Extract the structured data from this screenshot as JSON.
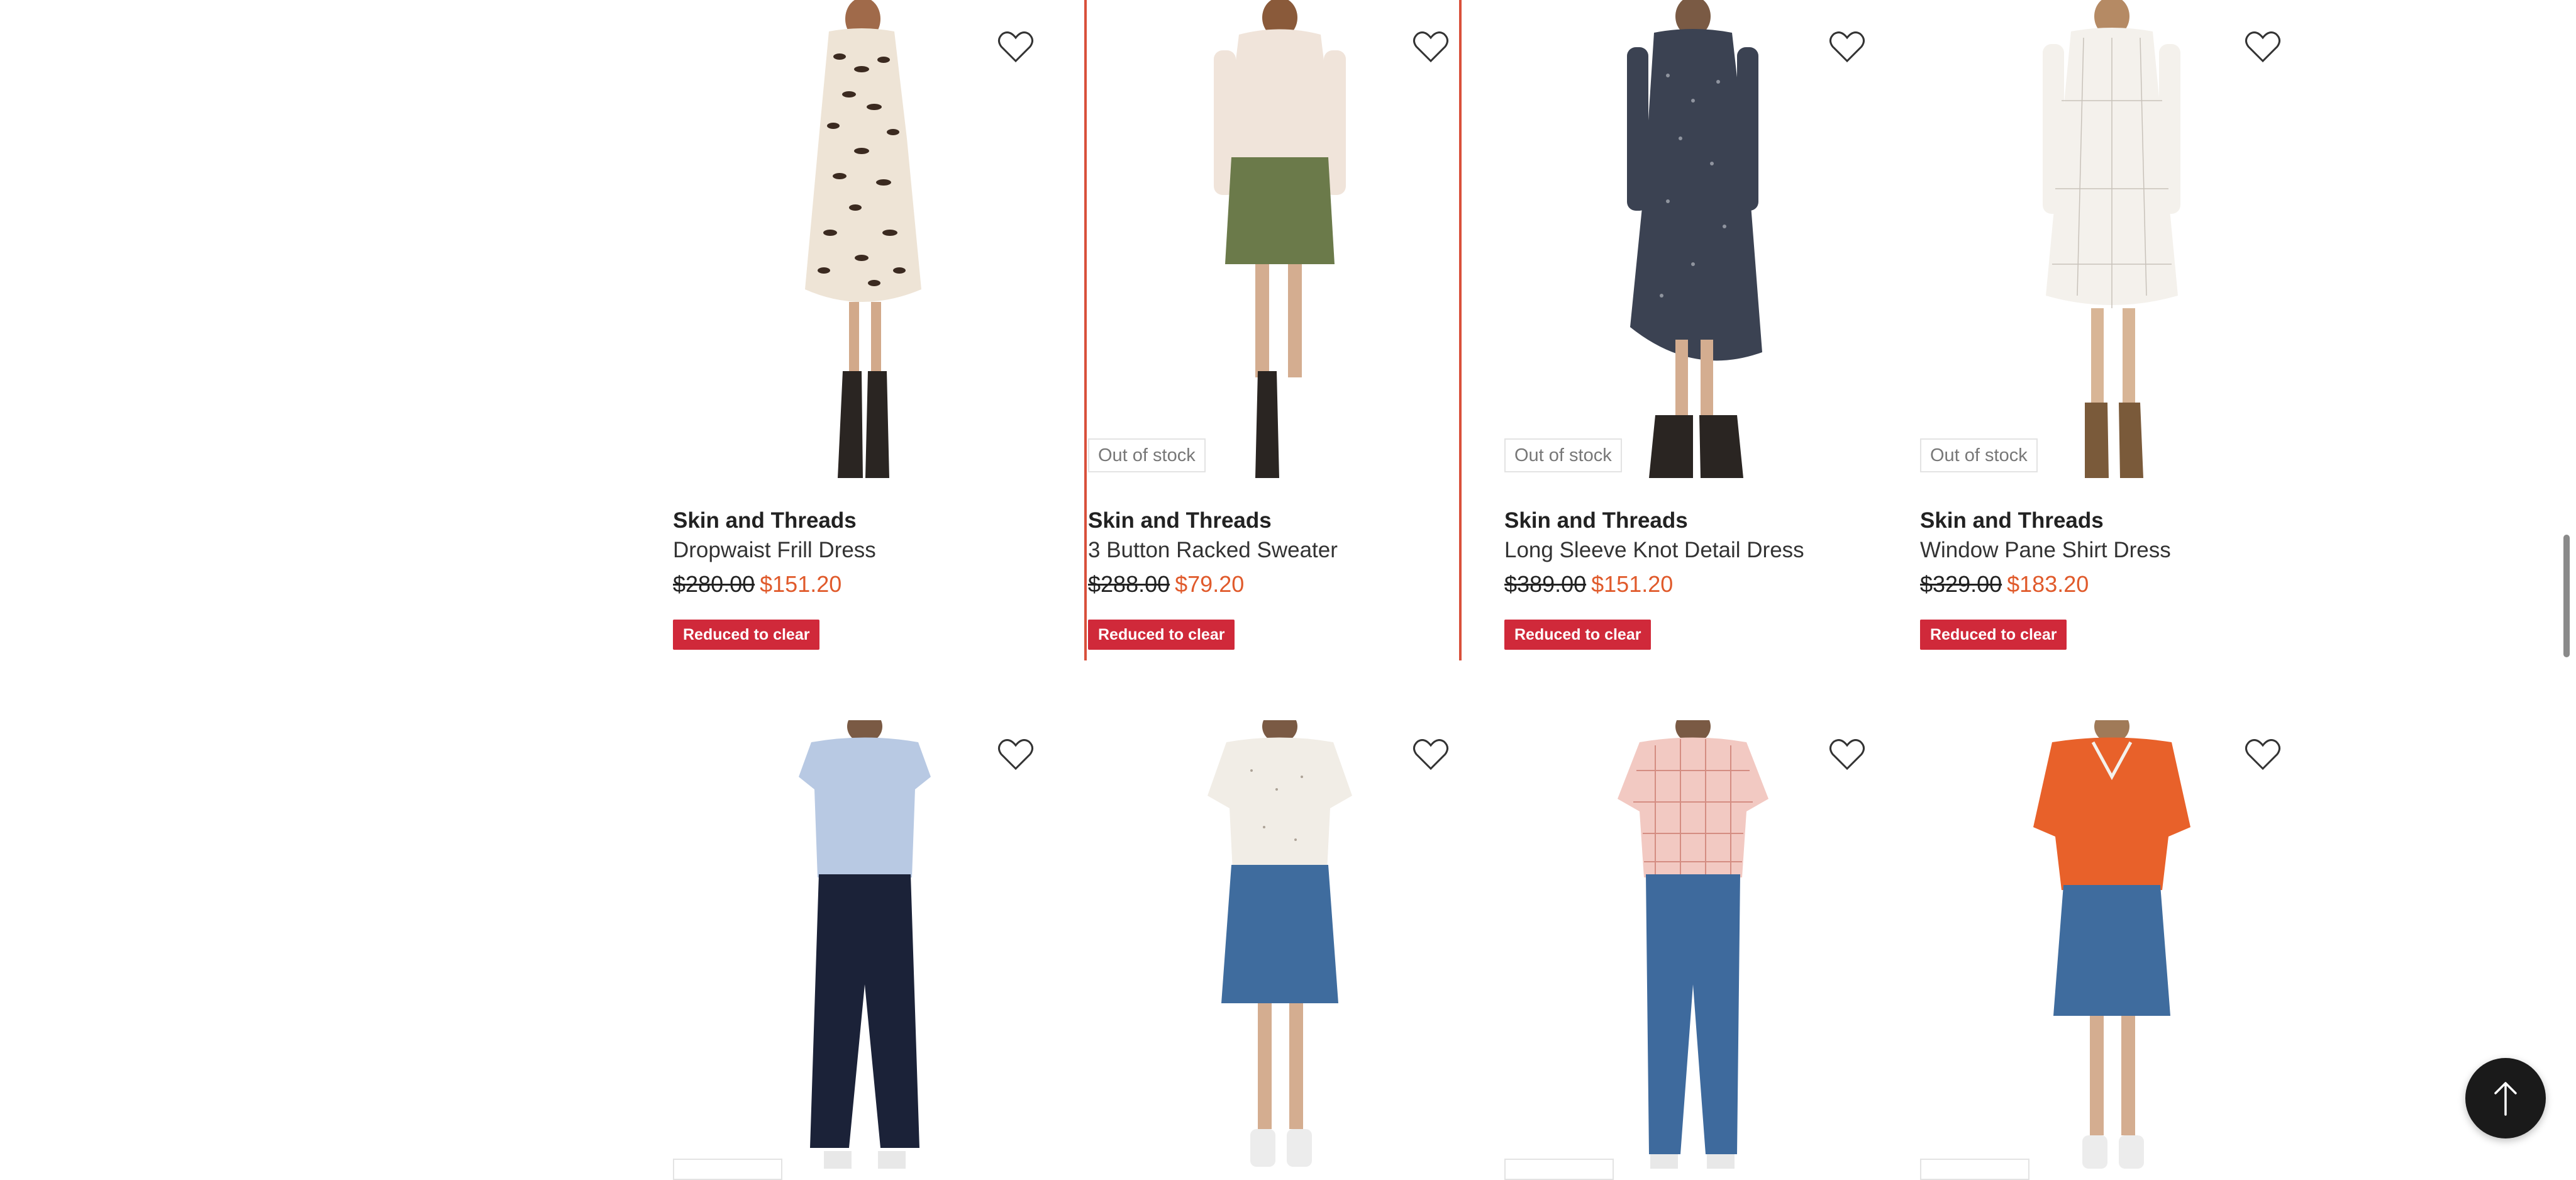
{
  "products_row1": [
    {
      "brand": "Skin and Threads",
      "name": "Dropwaist Frill Dress",
      "was": "$280.00",
      "now": "$151.20",
      "tag": "Reduced to clear",
      "out_of_stock": ""
    },
    {
      "brand": "Skin and Threads",
      "name": "3 Button Racked Sweater",
      "was": "$288.00",
      "now": "$79.20",
      "tag": "Reduced to clear",
      "out_of_stock": "Out of stock"
    },
    {
      "brand": "Skin and Threads",
      "name": "Long Sleeve Knot Detail Dress",
      "was": "$389.00",
      "now": "$151.20",
      "tag": "Reduced to clear",
      "out_of_stock": "Out of stock"
    },
    {
      "brand": "Skin and Threads",
      "name": "Window Pane Shirt Dress",
      "was": "$329.00",
      "now": "$183.20",
      "tag": "Reduced to clear",
      "out_of_stock": "Out of stock"
    }
  ],
  "colors": {
    "accent_price": "#e05a2b",
    "tag_bg": "#d0293a",
    "selection_border": "#d9503b"
  },
  "icons": {
    "favorite": "heart-outline-icon",
    "back_to_top": "arrow-up-icon"
  }
}
